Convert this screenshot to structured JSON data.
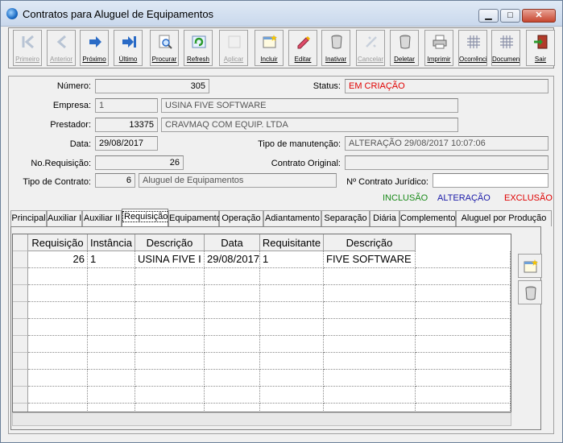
{
  "window": {
    "title": "Contratos para Aluguel de Equipamentos"
  },
  "toolbar": [
    {
      "label": "Primeiro",
      "icon": "first-record-icon",
      "enabled": false
    },
    {
      "label": "Anterior",
      "icon": "previous-record-icon",
      "enabled": false
    },
    {
      "label": "Próximo",
      "icon": "next-record-icon",
      "enabled": true
    },
    {
      "label": "Último",
      "icon": "last-record-icon",
      "enabled": true
    },
    {
      "label": "Procurar",
      "icon": "search-icon",
      "enabled": true
    },
    {
      "label": "Refresh",
      "icon": "refresh-icon",
      "enabled": true
    },
    {
      "label": "Aplicar",
      "icon": "apply-icon",
      "enabled": false
    },
    {
      "label": "Incluir",
      "icon": "new-record-icon",
      "enabled": true
    },
    {
      "label": "Editar",
      "icon": "edit-icon",
      "enabled": true
    },
    {
      "label": "Inativar",
      "icon": "deactivate-icon",
      "enabled": true
    },
    {
      "label": "Cancelar",
      "icon": "cancel-icon",
      "enabled": false
    },
    {
      "label": "Deletar",
      "icon": "delete-icon",
      "enabled": true
    },
    {
      "label": "Imprimir",
      "icon": "printer-icon",
      "enabled": true
    },
    {
      "label": "Ocorrência",
      "icon": "occurrence-grid-icon",
      "enabled": true
    },
    {
      "label": "Documento",
      "icon": "document-grid-icon",
      "enabled": true
    },
    {
      "label": "Sair",
      "icon": "exit-door-icon",
      "enabled": true
    }
  ],
  "form": {
    "numero": {
      "label": "Número:",
      "value": "305"
    },
    "status": {
      "label": "Status:",
      "value": "EM CRIAÇÃO"
    },
    "empresa": {
      "label": "Empresa:",
      "code": "1",
      "name": "USINA FIVE SOFTWARE"
    },
    "prestador": {
      "label": "Prestador:",
      "code": "13375",
      "name": "CRAVMAQ COM EQUIP. LTDA"
    },
    "data": {
      "label": "Data:",
      "value": "29/08/2017"
    },
    "tipo_manutencao": {
      "label": "Tipo de manutenção:",
      "value": "ALTERAÇÃO 29/08/2017 10:07:06"
    },
    "no_requisicao": {
      "label": "No.Requisição:",
      "value": "26"
    },
    "contrato_original": {
      "label": "Contrato Original:",
      "value": ""
    },
    "tipo_contrato": {
      "label": "Tipo de Contrato:",
      "code": "6",
      "name": "Aluguel de Equipamentos"
    },
    "contrato_juridico": {
      "label": "Nº Contrato Jurídico:",
      "value": ""
    }
  },
  "legend": {
    "inclusao": "INCLUSÃO",
    "alteracao": "ALTERAÇÃO",
    "exclusao": "EXCLUSÃO",
    "colors": {
      "inclusao": "#1a8a1a",
      "alteracao": "#1a1aa8",
      "exclusao": "#e00000"
    }
  },
  "tabs": [
    "Principal",
    "Auxiliar I",
    "Auxiliar II",
    "Requisição",
    "Equipamento",
    "Operação",
    "Adiantamento",
    "Separação",
    "Diária",
    "Complemento",
    "Aluguel por Produção"
  ],
  "active_tab": "Requisição",
  "grid": {
    "columns": [
      "Requisição",
      "Instância",
      "Descrição",
      "Data",
      "Requisitante",
      "Descrição"
    ],
    "rows": [
      [
        "26",
        "1",
        "USINA FIVE I",
        "29/08/2017",
        "1",
        "FIVE SOFTWARE"
      ]
    ]
  },
  "side_buttons": [
    {
      "name": "add-row-button",
      "icon": "new-record-icon"
    },
    {
      "name": "delete-row-button",
      "icon": "delete-icon"
    }
  ]
}
